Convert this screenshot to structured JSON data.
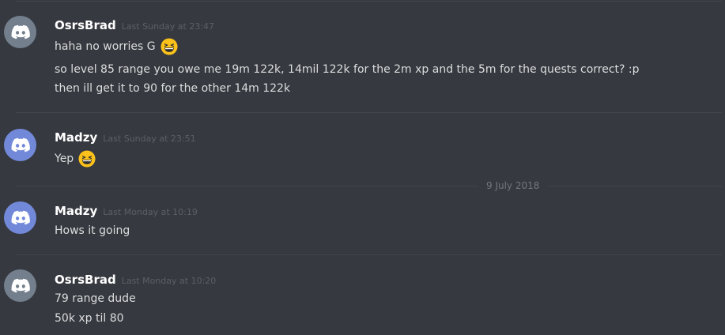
{
  "colors": {
    "background": "#36393f",
    "avatar_osrsbrad": "#747f8d",
    "avatar_madzy": "#7289da",
    "divider": "#42454a",
    "emoji": "#fcc21b"
  },
  "messages": [
    {
      "username": "OsrsBrad",
      "timestamp": "Last Sunday at 23:47",
      "avatar_icon": "discord-logo-icon",
      "lines": [
        {
          "text": "haha no worries G",
          "emoji": "grinning-squinting-face"
        },
        {
          "text": "so level 85 range you owe me 19m 122k, 14mil 122k for the 2m xp and the 5m for the quests correct? :p"
        },
        {
          "text": "then ill get it to 90 for the other 14m 122k"
        }
      ]
    },
    {
      "username": "Madzy",
      "timestamp": "Last Sunday at 23:51",
      "avatar_icon": "discord-logo-icon",
      "lines": [
        {
          "text": "Yep",
          "emoji": "grinning-squinting-face"
        }
      ]
    },
    {
      "username": "Madzy",
      "timestamp": "Last Monday at 10:19",
      "avatar_icon": "discord-logo-icon",
      "lines": [
        {
          "text": "Hows it going"
        }
      ]
    },
    {
      "username": "OsrsBrad",
      "timestamp": "Last Monday at 10:20",
      "avatar_icon": "discord-logo-icon",
      "lines": [
        {
          "text": "79 range dude"
        },
        {
          "text": "50k xp til 80"
        }
      ]
    }
  ],
  "date_separator": "9 July 2018"
}
